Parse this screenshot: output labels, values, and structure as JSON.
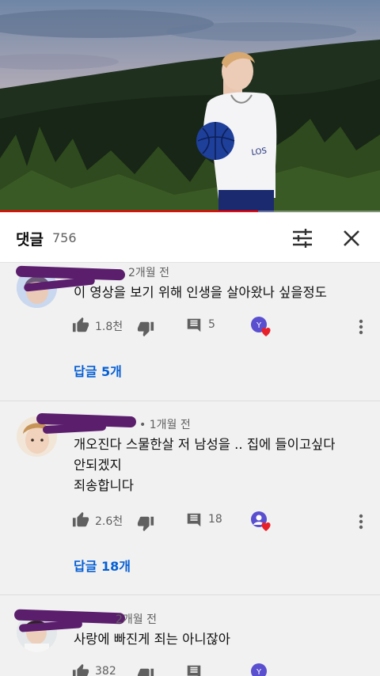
{
  "player": {
    "progress": 0.68
  },
  "comments_header": {
    "title": "댓글",
    "count": "756",
    "sort_icon": "tune-icon",
    "close_icon": "close-icon"
  },
  "comments": [
    {
      "time": "2개월 전",
      "text_lines": [
        "이 영상을 보기 위해 인생을 살아왔나 싶을정도"
      ],
      "likes": "1.8천",
      "reply_count": "5",
      "replies_link": "답글 5개"
    },
    {
      "time": "• 1개월 전",
      "text_lines": [
        "개오진다 스물한살 저 남성을 .. 집에 들이고싶다",
        "안되겠지",
        "죄송합니다"
      ],
      "likes": "2.6천",
      "reply_count": "18",
      "replies_link": "답글 18개"
    },
    {
      "time": "2개월 전",
      "text_lines": [
        "사랑에 빠진게 죄는 아니잖아"
      ],
      "likes": "382"
    }
  ],
  "colors": {
    "accent": "#065fd4",
    "progress": "#ff0000",
    "redaction": "#5b1e6d",
    "heart": "#e8202a"
  },
  "icons": {
    "like": "thumb-up-icon",
    "dislike": "thumb-down-icon",
    "reply": "comment-icon",
    "more": "more-vert-icon",
    "creator_heart": "creator-heart-icon"
  }
}
